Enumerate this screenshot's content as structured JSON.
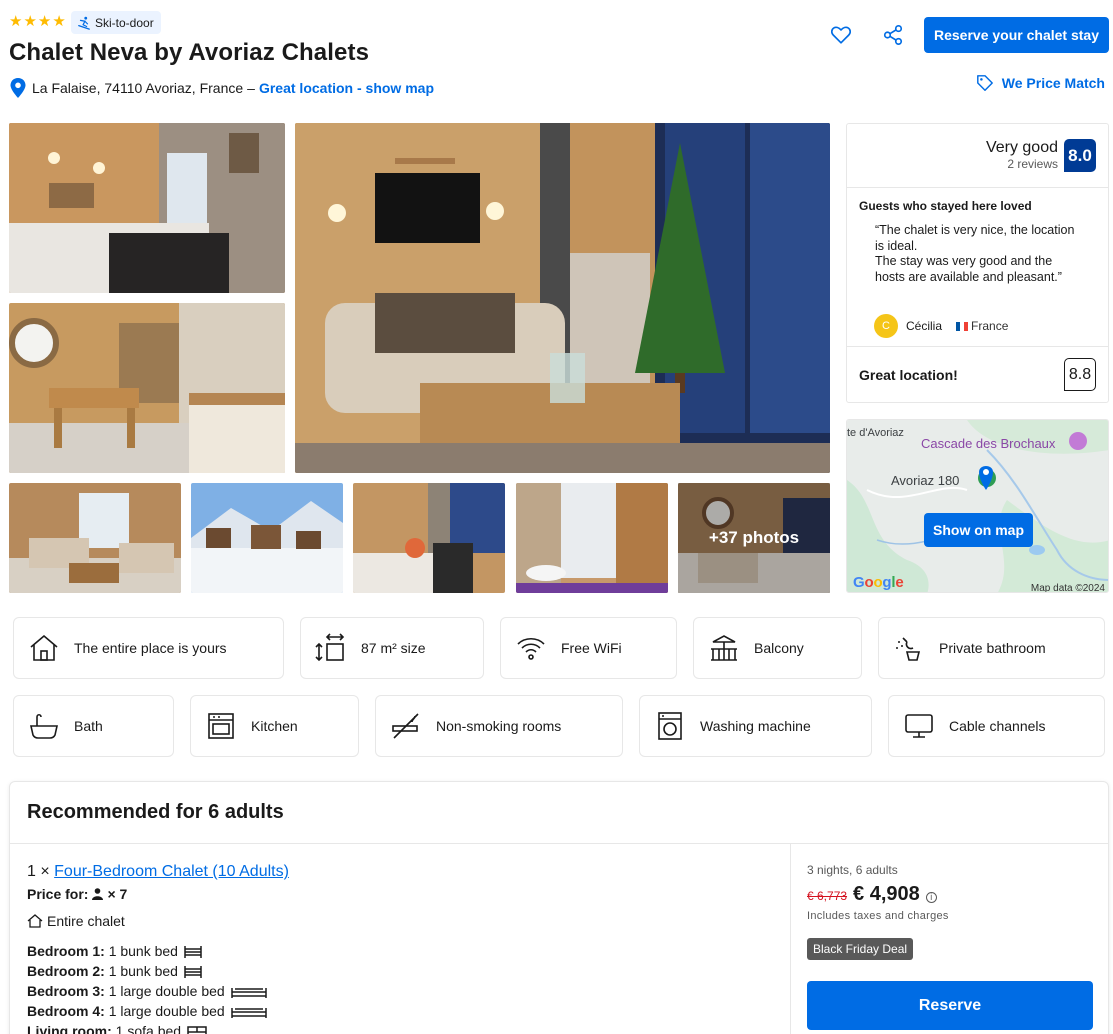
{
  "header": {
    "star_count": 4,
    "ski_badge": "Ski-to-door",
    "title": "Chalet Neva by Avoriaz Chalets",
    "address": "La Falaise, 74110 Avoriaz, France",
    "address_sep": "–",
    "location_link": "Great location - show map",
    "reserve_button": "Reserve your chalet stay",
    "price_match": "We Price Match"
  },
  "gallery": {
    "more_photos": "+37 photos"
  },
  "review": {
    "verdict": "Very good",
    "count": "2 reviews",
    "score": "8.0",
    "loved_heading": "Guests who stayed here loved",
    "quote_line1": "“The chalet is very nice, the location is ideal.",
    "quote_line2": "The stay was very good and the hosts are available and pleasant.”",
    "author_initial": "C",
    "author": "Cécilia",
    "country": "France",
    "location_label": "Great location!",
    "location_score": "8.8"
  },
  "map": {
    "label_top": "te d'Avoriaz",
    "label_cascade": "Cascade des Brochaux",
    "label_avoriaz": "Avoriaz 180",
    "show_button": "Show on map",
    "google": "Google",
    "map_data": "Map data ©2024"
  },
  "facilities": {
    "row1": [
      "The entire place is yours",
      "87 m² size",
      "Free WiFi",
      "Balcony",
      "Private bathroom"
    ],
    "row2": [
      "Bath",
      "Kitchen",
      "Non-smoking rooms",
      "Washing machine",
      "Cable channels"
    ]
  },
  "recommended": {
    "title": "Recommended for 6 adults",
    "qty": "1 ×",
    "room_name": "Four-Bedroom Chalet (10 Adults)",
    "price_for": "Price for:",
    "guests": "× 7",
    "entire": "Entire chalet",
    "beds": [
      {
        "label": "Bedroom 1:",
        "value": "1 bunk bed"
      },
      {
        "label": "Bedroom 2:",
        "value": "1 bunk bed"
      },
      {
        "label": "Bedroom 3:",
        "value": "1 large double bed"
      },
      {
        "label": "Bedroom 4:",
        "value": "1 large double bed"
      },
      {
        "label": "Living room:",
        "value": "1 sofa bed"
      }
    ],
    "nights": "3 nights, 6 adults",
    "old_price": "€ 6,773",
    "new_price": "€ 4,908",
    "taxes": "Includes taxes and charges",
    "deal": "Black Friday Deal",
    "reserve": "Reserve"
  },
  "colors": {
    "brand_blue": "#006ce4",
    "score_blue": "#003b95",
    "star_yellow": "#febb02",
    "strike_red": "#d4111e"
  },
  "icons": {
    "stars": "star-icon",
    "ski": "skier-icon",
    "pin": "map-pin-icon",
    "fav": "heart-icon",
    "share": "share-icon",
    "pricematch": "tag-icon"
  }
}
